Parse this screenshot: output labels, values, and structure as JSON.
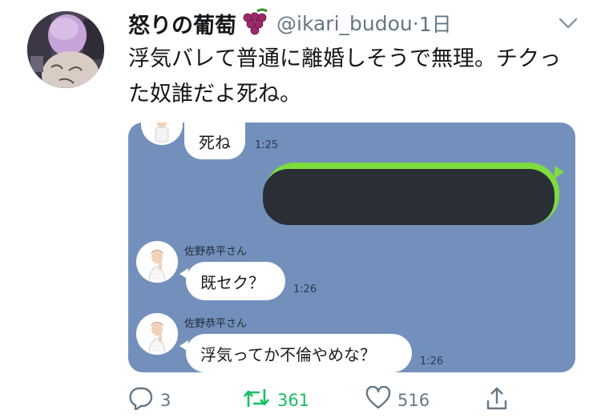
{
  "tweet": {
    "display_name": "怒りの葡萄",
    "handle": "@ikari_budou",
    "separator": "·",
    "time": "1日",
    "text": "浮気バレて普通に離婚しそうで無理。チクった奴誰だよ死ね。"
  },
  "media": {
    "messages": [
      {
        "text": "死ね",
        "time": "1:25"
      },
      {
        "sender": "佐野恭平さん",
        "text": "既セク？",
        "time": "1:26"
      },
      {
        "sender": "佐野恭平さん",
        "text": "浮気ってか不倫やめな？",
        "time": "1:26"
      }
    ]
  },
  "actions": {
    "reply_count": "3",
    "retweet_count": "361",
    "like_count": "516"
  },
  "colors": {
    "retweet_green": "#17bf63",
    "line_background": "#7390bc",
    "line_green_bubble": "#7edc3f"
  },
  "icons": [
    "grapes-emoji-icon",
    "chevron-down-icon",
    "reply-icon",
    "retweet-icon",
    "heart-icon",
    "share-icon"
  ]
}
